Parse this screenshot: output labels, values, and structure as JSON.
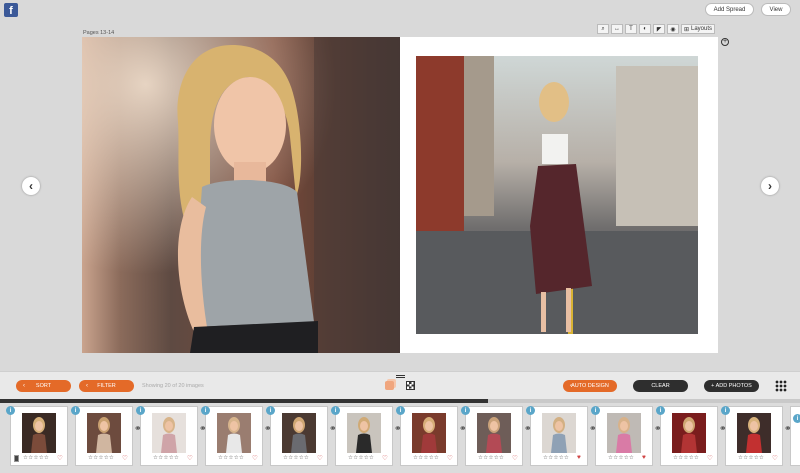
{
  "header": {
    "facebook_glyph": "f",
    "add_spread_label": "Add Spread",
    "view_label": "View"
  },
  "spread": {
    "pages_label": "Pages 13-14",
    "toolbar": {
      "zoom_icon": "⌕",
      "width_icon": "↔",
      "text_icon": "T",
      "fill_icon": "◐",
      "pin_icon": "◤",
      "eye_icon": "◉",
      "layouts_icon": "⊞",
      "layouts_label": "Layouts"
    },
    "add_icon": "+",
    "prev_arrow": "‹",
    "next_arrow": "›"
  },
  "toolbar": {
    "sort_label": "SORT",
    "filter_label": "FILTER",
    "status_text": "Showing 20 of 20 images",
    "auto_design_label": "AUTO DESIGN",
    "clear_label": "CLEAR",
    "add_photos_label": "+ ADD PHOTOS",
    "chevron": "‹"
  },
  "progress": {
    "fraction": 0.61
  },
  "strip": {
    "info_glyph": "i",
    "rating_stars": "☆☆☆☆☆",
    "heart_empty": "♡",
    "heart_full": "♥",
    "link_glyph": "⚭",
    "thumbs": [
      {
        "favorite": false,
        "used": true
      },
      {
        "favorite": false,
        "used": false
      },
      {
        "favorite": false,
        "used": false
      },
      {
        "favorite": false,
        "used": false
      },
      {
        "favorite": false,
        "used": false
      },
      {
        "favorite": false,
        "used": false
      },
      {
        "favorite": false,
        "used": false
      },
      {
        "favorite": false,
        "used": false
      },
      {
        "favorite": true,
        "used": false
      },
      {
        "favorite": true,
        "used": false
      },
      {
        "favorite": false,
        "used": false
      },
      {
        "favorite": false,
        "used": false
      }
    ]
  },
  "colors": {
    "accent": "#e46a28",
    "dark_button": "#2e2e2e",
    "info_badge": "#5aa6c9",
    "facebook": "#3b5998"
  }
}
